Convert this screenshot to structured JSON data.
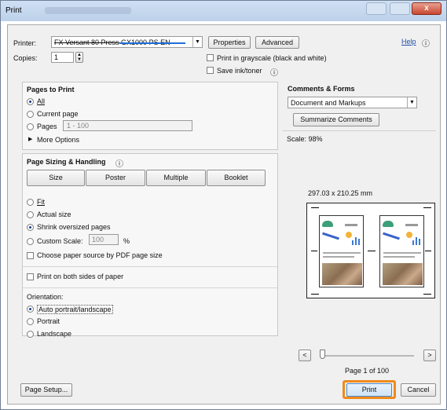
{
  "window": {
    "title": "Print",
    "close_glyph": "x"
  },
  "printer": {
    "label": "Printer:",
    "name": "FX Versant 80 Press GX1000 PS EN"
  },
  "copies": {
    "label": "Copies:",
    "value": "1"
  },
  "buttons": {
    "properties": "Properties",
    "advanced": "Advanced",
    "help": "Help",
    "page_setup": "Page Setup...",
    "print": "Print",
    "cancel": "Cancel"
  },
  "options": {
    "grayscale": "Print in grayscale (black and white)",
    "save_ink": "Save ink/toner"
  },
  "pages_to_print": {
    "title": "Pages to Print",
    "all": "All",
    "current_page": "Current page",
    "pages": "Pages",
    "pages_value": "1 - 100",
    "more_options": "More Options"
  },
  "sizing": {
    "title": "Page Sizing & Handling",
    "tabs": [
      "Size",
      "Poster",
      "Multiple",
      "Booklet"
    ],
    "fit": "Fit",
    "actual_size": "Actual size",
    "shrink": "Shrink oversized pages",
    "custom_scale": "Custom Scale:",
    "custom_value": "100",
    "percent": "%",
    "paper_source": "Choose paper source by PDF page size",
    "both_sides": "Print on both sides of paper",
    "orientation_label": "Orientation:",
    "auto": "Auto portrait/landscape",
    "portrait": "Portrait",
    "landscape": "Landscape"
  },
  "comments": {
    "title": "Comments & Forms",
    "selected": "Document and Markups",
    "summarize": "Summarize Comments"
  },
  "preview": {
    "scale": "Scale: 98%",
    "dimensions": "297.03 x 210.25 mm",
    "page_counter": "Page 1 of 100",
    "prev_glyph": "<",
    "next_glyph": ">"
  },
  "accent_color": "#f08a1c"
}
